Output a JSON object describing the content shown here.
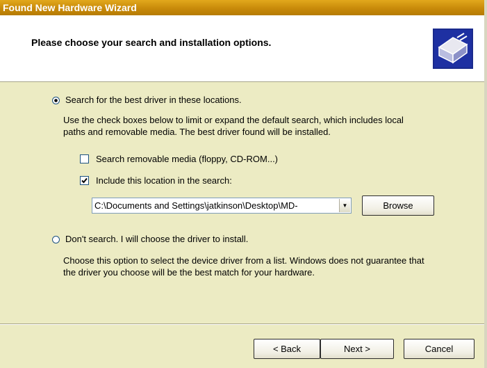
{
  "window": {
    "title": "Found New Hardware Wizard"
  },
  "header": {
    "title": "Please choose your search and installation options.",
    "icon": "hardware-install-icon"
  },
  "options": {
    "search": {
      "label": "Search for the best driver in these locations.",
      "selected": true,
      "description_line1": "Use the check boxes below to limit or expand the default search, which includes local",
      "description_line2": "paths and removable media. The best driver found will be installed.",
      "removable_media": {
        "label": "Search removable media (floppy, CD-ROM...)",
        "checked": false
      },
      "include_location": {
        "label": "Include this location in the search:",
        "checked": true
      },
      "location_value": "C:\\Documents and Settings\\jatkinson\\Desktop\\MD-",
      "browse_label": "Browse"
    },
    "dont_search": {
      "label": "Don't search. I will choose the driver to install.",
      "selected": false,
      "description_line1": "Choose this option to select the device driver from a list.  Windows does not guarantee that",
      "description_line2": "the driver you choose will be the best match for your hardware."
    }
  },
  "buttons": {
    "back": "< Back",
    "next": "Next >",
    "cancel": "Cancel"
  },
  "colors": {
    "titlebar": "#c88a0a",
    "body_bg": "#ecebc3",
    "header_bg": "#ffffff"
  }
}
